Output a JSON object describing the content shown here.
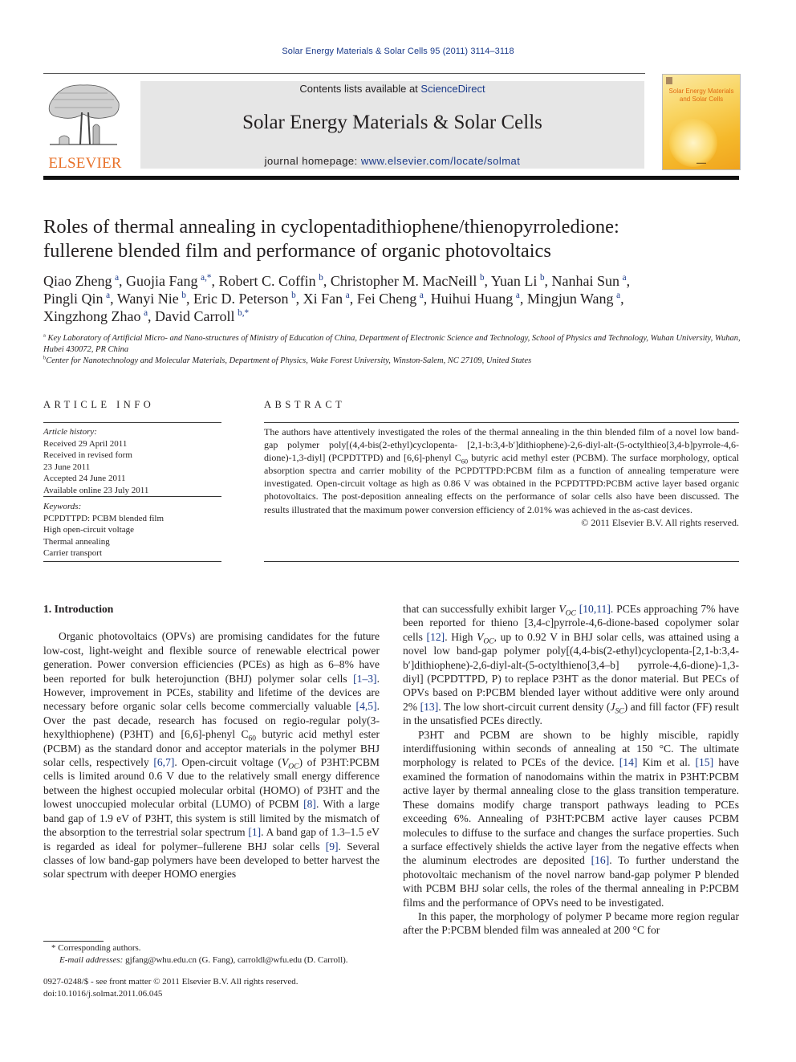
{
  "running_head": "Solar Energy Materials & Solar Cells 95 (2011) 3114–3118",
  "masthead": {
    "publisher_logo_text": "ELSEVIER",
    "contents_prefix": "Contents lists available at ",
    "contents_link": "ScienceDirect",
    "journal_title": "Solar Energy Materials & Solar Cells",
    "homepage_prefix": "journal homepage: ",
    "homepage_link": "www.elsevier.com/locate/solmat",
    "cover_title_line1": "Solar Energy Materials",
    "cover_title_line2": "and Solar Cells"
  },
  "article": {
    "title_line1": "Roles of thermal annealing in cyclopentadithiophene/thienopyrroledione:",
    "title_line2": "fullerene blended film and performance of organic photovoltaics",
    "authors": [
      {
        "name": "Qiao Zheng",
        "aff": "a"
      },
      {
        "name": "Guojia Fang",
        "aff": "a,*"
      },
      {
        "name": "Robert C. Coffin",
        "aff": "b"
      },
      {
        "name": "Christopher M. MacNeill",
        "aff": "b"
      },
      {
        "name": "Yuan Li",
        "aff": "b"
      },
      {
        "name": "Nanhai Sun",
        "aff": "a"
      },
      {
        "name": "Pingli Qin",
        "aff": "a"
      },
      {
        "name": "Wanyi Nie",
        "aff": "b"
      },
      {
        "name": "Eric D. Peterson",
        "aff": "b"
      },
      {
        "name": "Xi Fan",
        "aff": "a"
      },
      {
        "name": "Fei Cheng",
        "aff": "a"
      },
      {
        "name": "Huihui Huang",
        "aff": "a"
      },
      {
        "name": "Mingjun Wang",
        "aff": "a"
      },
      {
        "name": "Xingzhong Zhao",
        "aff": "a"
      },
      {
        "name": "David Carroll",
        "aff": "b,*"
      }
    ],
    "affiliations": [
      {
        "mark": "a",
        "text": "Key Laboratory of Artificial Micro- and Nano-structures of Ministry of Education of China, Department of Electronic Science and Technology, School of Physics and Technology, Wuhan University, Wuhan, Hubei 430072, PR China"
      },
      {
        "mark": "b",
        "text": "Center for Nanotechnology and Molecular Materials, Department of Physics, Wake Forest University, Winston-Salem, NC 27109, United States"
      }
    ]
  },
  "article_info": {
    "heading": "ARTICLE INFO",
    "history_label": "Article history:",
    "history": [
      "Received 29 April 2011",
      "Received in revised form",
      "23 June 2011",
      "Accepted 24 June 2011",
      "Available online 23 July 2011"
    ],
    "keywords_label": "Keywords:",
    "keywords": [
      "PCPDTTPD: PCBM blended film",
      "High open-circuit voltage",
      "Thermal annealing",
      "Carrier transport"
    ]
  },
  "abstract": {
    "heading": "ABSTRACT",
    "text_part1": "The authors have attentively investigated the roles of the thermal annealing in the thin blended film of a novel low band-gap polymer poly[(4,4-bis(2-ethyl)cyclopenta- [2,1-b:3,4-b′]dithiophene)-2,6-diyl-alt-(5-octylthieo[3,4-b]pyrrole-4,6-dione)-1,3-diyl] (PCPDTTPD) and [6,6]-phenyl C",
    "text_sub": "60",
    "text_part2": " butyric acid methyl ester (PCBM). The surface morphology, optical absorption spectra and carrier mobility of the PCPDTTPD:PCBM film as a function of annealing temperature were investigated. Open-circuit voltage as high as 0.86 V was obtained in the PCPDTTPD:PCBM active layer based organic photovoltaics. The post-deposition annealing effects on the performance of solar cells also have been discussed. The results illustrated that the maximum power conversion efficiency of 2.01% was achieved in the as-cast devices.",
    "copyright": "© 2011 Elsevier B.V. All rights reserved."
  },
  "body": {
    "section_heading": "1.  Introduction",
    "col1": {
      "p1_a": "Organic photovoltaics (OPVs) are promising candidates for the future low-cost, light-weight and flexible source of renewable electrical power generation. Power conversion efficiencies (PCEs) as high as 6–8% have been reported for bulk heterojunction (BHJ) polymer solar cells ",
      "ref1": "[1–3]",
      "p1_b": ". However, improvement in PCEs, stability and lifetime of the devices are necessary before organic solar cells become commercially valuable ",
      "ref2": "[4,5]",
      "p1_c": ". Over the past decade, research has focused on regio-regular poly(3-hexylthiophene) (P3HT) and [6,6]-phenyl C",
      "c60": "60",
      "p1_d": " butyric acid methyl ester (PCBM) as the standard donor and acceptor materials in the polymer BHJ solar cells, respectively ",
      "ref3": "[6,7]",
      "p1_e": ". Open-circuit voltage (",
      "voc": "V",
      "voc_sub": "OC",
      "p1_f": ") of P3HT:PCBM cells is limited around 0.6 V due to the relatively small energy difference between the highest occupied molecular orbital (HOMO) of P3HT and the lowest unoccupied molecular orbital (LUMO) of PCBM ",
      "ref4": "[8]",
      "p1_g": ". With a large band gap of 1.9 eV of P3HT, this system is still limited by the mismatch of the absorption to the terrestrial solar spectrum ",
      "ref5": "[1]",
      "p1_h": ". A band gap of 1.3–1.5 eV is regarded as ideal for polymer–fullerene BHJ solar cells ",
      "ref6": "[9]",
      "p1_i": ". Several classes of low band-gap polymers have been developed to better harvest the solar spectrum with deeper HOMO energies"
    },
    "col2": {
      "p1_a": "that can successfully exhibit larger ",
      "voc": "V",
      "voc_sub": "OC",
      "ref1": "[10,11]",
      "p1_b": ". PCEs approaching 7% have been reported for thieno [3,4-c]pyrrole-4,6-dione-based copolymer solar cells ",
      "ref2": "[12]",
      "p1_c": ". High ",
      "p1_d": ", up to 0.92 V in BHJ solar cells, was attained using a novel low band-gap polymer poly[(4,4-bis(2-ethyl)cyclopenta-[2,1-b:3,4-b′]dithiophene)-2,6-diyl-alt-(5-octylthieno[3,4–b]  pyrrole-4,6-dione)-1,3-diyl] (PCPDTTPD, P) to replace P3HT as the donor material. But PECs of OPVs based on P:PCBM blended layer without additive were only around 2% ",
      "ref3": "[13]",
      "p1_e": ". The low short-circuit current density (",
      "jsc": "J",
      "jsc_sub": "SC",
      "p1_f": ") and fill factor (FF) result in the unsatisfied PCEs directly.",
      "p2_a": "P3HT and PCBM are shown to be highly miscible, rapidly interdiffusioning within seconds of annealing at 150 °C. The ultimate morphology is related to PCEs of the device. ",
      "ref4": "[14]",
      "p2_b": " Kim et al. ",
      "ref5": "[15]",
      "p2_c": " have examined the formation of nanodomains within the matrix in P3HT:PCBM active layer by thermal annealing close to the glass transition temperature. These domains modify charge transport pathways leading to PCEs exceeding 6%. Annealing of P3HT:PCBM active layer causes PCBM molecules to diffuse to the surface and changes the surface properties. Such a surface effectively shields the active layer from the negative effects when the aluminum electrodes are deposited ",
      "ref6": "[16]",
      "p2_d": ". To further understand the photovoltaic mechanism of the novel narrow band-gap polymer P blended with PCBM BHJ solar cells, the roles of the thermal annealing in P:PCBM films and the performance of OPVs need to be investigated.",
      "p3": "In this paper, the morphology of polymer P became more region regular after the P:PCBM blended film was annealed at 200 °C for"
    }
  },
  "footnotes": {
    "corresponding": "* Corresponding authors.",
    "email_label": "E-mail addresses: ",
    "emails": "gjfang@whu.edu.cn (G. Fang), carroldl@wfu.edu (D. Carroll).",
    "issn": "0927-0248/$ - see front matter © 2011 Elsevier B.V. All rights reserved.",
    "doi": "doi:10.1016/j.solmat.2011.06.045"
  }
}
